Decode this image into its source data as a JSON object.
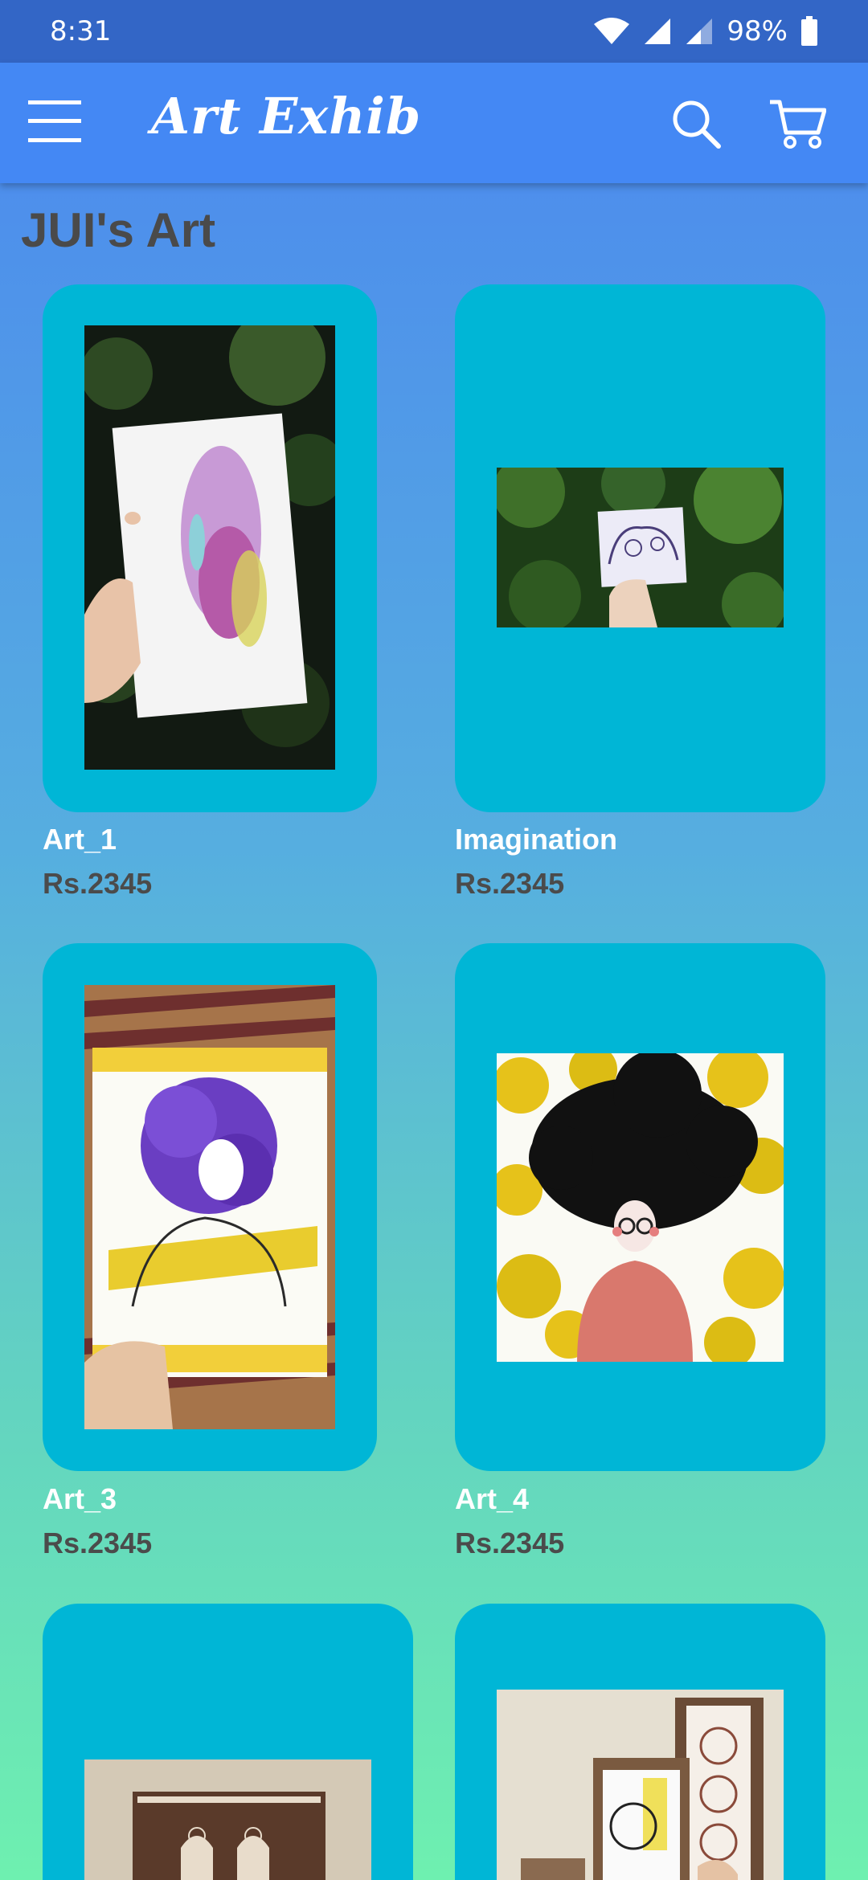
{
  "status_bar": {
    "time": "8:31",
    "battery": "98%",
    "icons": [
      "wifi-icon",
      "signal-icon",
      "signal-icon",
      "battery-icon"
    ]
  },
  "app_bar": {
    "title": "Art Exhib",
    "icons": [
      "menu-icon",
      "search-icon",
      "cart-icon"
    ]
  },
  "section": {
    "title": "JUI's Art"
  },
  "products": [
    {
      "name": "Art_1",
      "price": "Rs.2345"
    },
    {
      "name": "Imagination",
      "price": "Rs.2345"
    },
    {
      "name": "Art_3",
      "price": "Rs.2345"
    },
    {
      "name": "Art_4",
      "price": "Rs.2345"
    },
    {
      "name": "",
      "price": ""
    },
    {
      "name": "",
      "price": ""
    }
  ],
  "colors": {
    "status_bar": "#3366c6",
    "app_bar": "#4488f4",
    "card": "#00b6d6",
    "title_text": "#4a4a4a",
    "price_text": "#4b4b4b"
  }
}
